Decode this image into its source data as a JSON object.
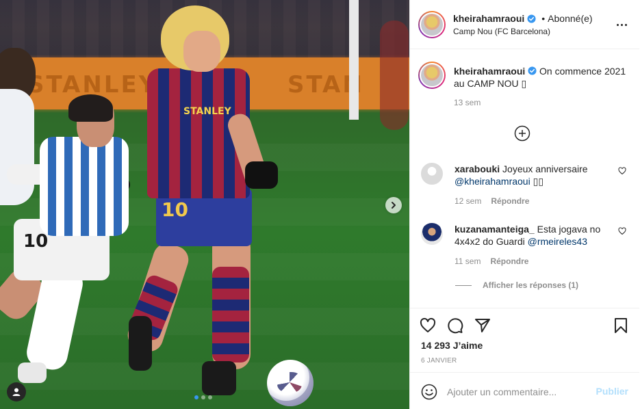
{
  "header": {
    "username": "kheirahamraoui",
    "separator": "•",
    "follow_status": "Abonné(e)",
    "location": "Camp Nou (FC Barcelona)",
    "more_icon": "more-horizontal-icon"
  },
  "caption": {
    "username": "kheirahamraoui",
    "text": "On commence 2021 au CAMP NOU ▯",
    "time": "13 sem"
  },
  "photo": {
    "board_text_1": "STANLEY",
    "board_text_2": "STAN",
    "jersey_sponsor": "STANLEY",
    "jersey_number": "10",
    "jersey_number_opponent": "10",
    "carousel_dots": 3,
    "carousel_active": 1
  },
  "comments": [
    {
      "username": "xarabouki",
      "text": "Joyeux anniversaire ",
      "mention": "@kheirahamraoui",
      "tail": " ▯▯",
      "time": "12 sem",
      "reply_label": "Répondre"
    },
    {
      "username": "kuzanamanteiga_",
      "text": "Esta jogava no 4x4x2 do Guardi ",
      "mention": "@rmeireles43",
      "tail": "",
      "time": "11 sem",
      "reply_label": "Répondre"
    }
  ],
  "replies_label": "Afficher les réponses (1)",
  "likes": "14 293 J’aime",
  "date": "6 JANVIER",
  "add_comment": {
    "placeholder": "Ajouter un commentaire...",
    "publish_label": "Publier"
  },
  "colors": {
    "accent": "#3897f0",
    "publish_disabled": "#b2dffc",
    "mention": "#00376b",
    "secondary_text": "#8e8e8e"
  }
}
